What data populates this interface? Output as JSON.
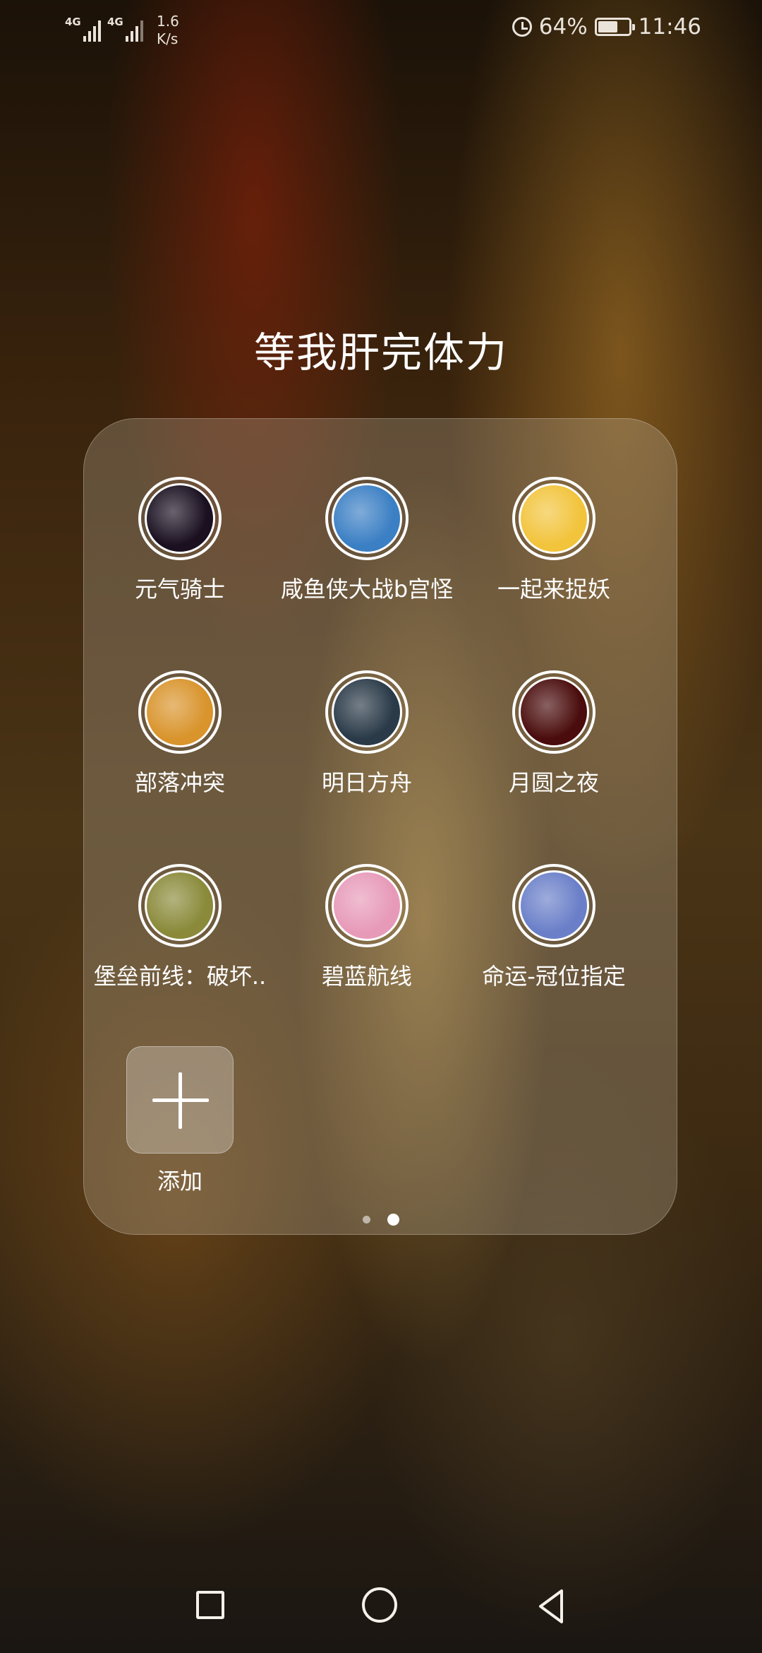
{
  "status_bar": {
    "network1": "4G",
    "network2": "4G",
    "speed_value": "1.6",
    "speed_unit": "K/s",
    "battery": "64%",
    "battery_level": 0.64,
    "time": "11:46"
  },
  "folder": {
    "title": "等我肝完体力",
    "apps": [
      {
        "label": "元气骑士",
        "icon": "soul-knight-icon",
        "color": "#1a1020"
      },
      {
        "label": "咸鱼侠大战b宫怪",
        "icon": "salted-fish-icon",
        "color": "#3b7fc4"
      },
      {
        "label": "一起来捉妖",
        "icon": "catch-demon-icon",
        "color": "#f2c43c"
      },
      {
        "label": "部落冲突",
        "icon": "clash-of-clans-icon",
        "color": "#d9942c"
      },
      {
        "label": "明日方舟",
        "icon": "arknights-icon",
        "color": "#2a3a48"
      },
      {
        "label": "月圆之夜",
        "icon": "full-moon-night-icon",
        "color": "#4a0c0c"
      },
      {
        "label": "堡垒前线：破坏..",
        "icon": "fortress-front-icon",
        "color": "#8a8a3a"
      },
      {
        "label": "碧蓝航线",
        "icon": "azur-lane-icon",
        "color": "#e79ab8"
      },
      {
        "label": "命运-冠位指定",
        "icon": "fate-grand-order-icon",
        "color": "#6a7fc8"
      }
    ],
    "add_label": "添加"
  },
  "pagination": {
    "pages": 2,
    "current": 2
  },
  "nav": {
    "recent": "recent-apps-icon",
    "home": "home-icon",
    "back": "back-icon"
  }
}
